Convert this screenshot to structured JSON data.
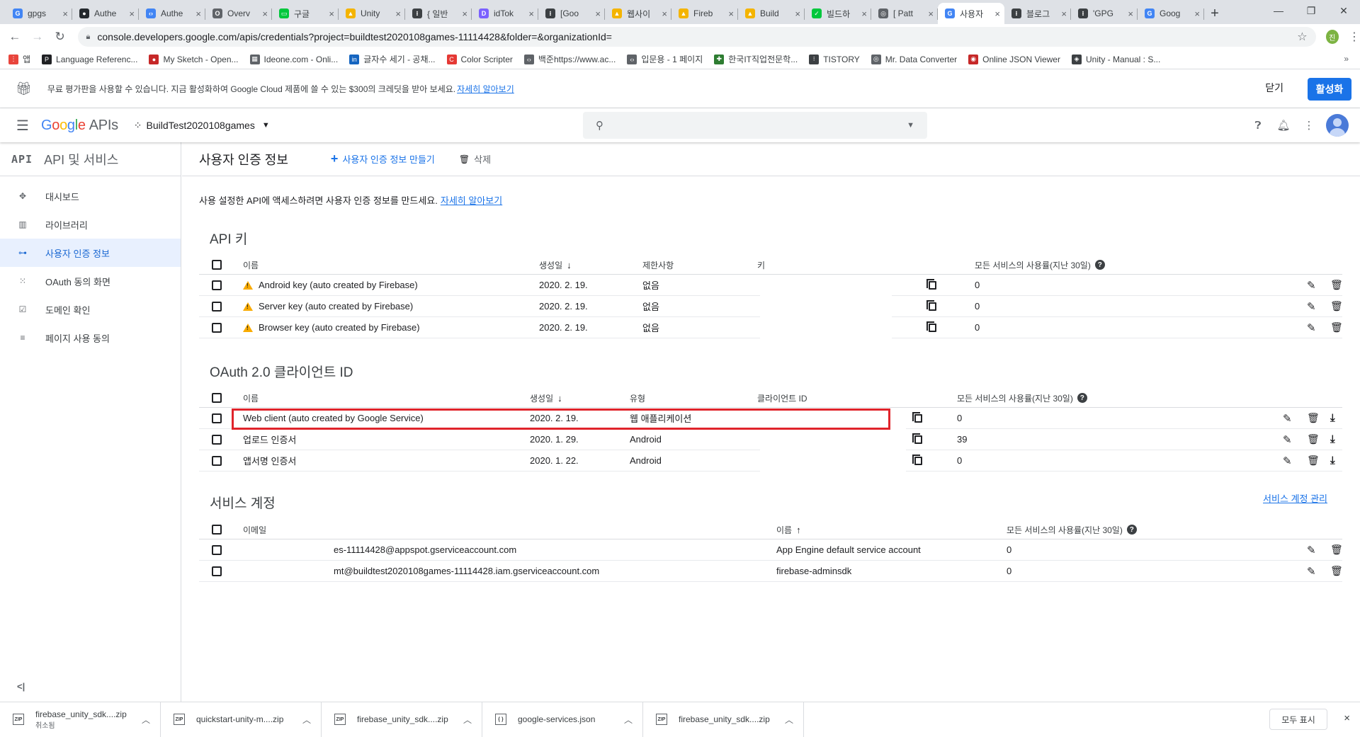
{
  "browser": {
    "tabs": [
      {
        "title": "gpgs",
        "color": "#4285f4",
        "glyph": "G"
      },
      {
        "title": "Authe",
        "color": "#24292e",
        "glyph": "●"
      },
      {
        "title": "Authe",
        "color": "#4285f4",
        "glyph": "‹›"
      },
      {
        "title": "Overv",
        "color": "#5f6368",
        "glyph": "O"
      },
      {
        "title": "구글",
        "color": "#00c73c",
        "glyph": "▭"
      },
      {
        "title": "Unity",
        "color": "#f4b400",
        "glyph": "▲"
      },
      {
        "title": "{ 일반",
        "color": "#3c4043",
        "glyph": "⁝"
      },
      {
        "title": "idTok",
        "color": "#7b61ff",
        "glyph": "D"
      },
      {
        "title": "[Goo",
        "color": "#3c4043",
        "glyph": "⁝"
      },
      {
        "title": "웹사이",
        "color": "#f4b400",
        "glyph": "▲"
      },
      {
        "title": "Fireb",
        "color": "#f4b400",
        "glyph": "▲"
      },
      {
        "title": "Build",
        "color": "#f4b400",
        "glyph": "▲"
      },
      {
        "title": "빌드하",
        "color": "#00c73c",
        "glyph": "✓"
      },
      {
        "title": "[ Patt",
        "color": "#5f6368",
        "glyph": "◎"
      },
      {
        "title": "사용자",
        "color": "#4285f4",
        "glyph": "G",
        "active": true
      },
      {
        "title": "블로그",
        "color": "#3c4043",
        "glyph": "⁝"
      },
      {
        "title": "'GPG",
        "color": "#3c4043",
        "glyph": "⁝"
      },
      {
        "title": "Goog",
        "color": "#4285f4",
        "glyph": "G"
      }
    ],
    "close_glyph": "×",
    "new_tab": "+",
    "url": "console.developers.google.com/apis/credentials?project=buildtest2020108games-11114428&folder=&organizationId=",
    "profile_initial": "진",
    "bookmarks": [
      {
        "label": "앱",
        "color": "#e8453c",
        "glyph": "⋮"
      },
      {
        "label": "Language Referenc...",
        "color": "#202124",
        "glyph": "P"
      },
      {
        "label": "My Sketch - Open...",
        "color": "#c62828",
        "glyph": "●"
      },
      {
        "label": "Ideone.com - Onli...",
        "color": "#5f6368",
        "glyph": "▦"
      },
      {
        "label": "글자수 세기 - 공채...",
        "color": "#1565c0",
        "glyph": "in"
      },
      {
        "label": "Color Scripter",
        "color": "#e53935",
        "glyph": "C"
      },
      {
        "label": "백준https://www.ac...",
        "color": "#5f6368",
        "glyph": "‹›"
      },
      {
        "label": "입문용 - 1 페이지",
        "color": "#5f6368",
        "glyph": "‹›"
      },
      {
        "label": "한국IT직업전문학...",
        "color": "#2e7d32",
        "glyph": "✚"
      },
      {
        "label": "TISTORY",
        "color": "#3c4043",
        "glyph": "⁝"
      },
      {
        "label": "Mr. Data Converter",
        "color": "#5f6368",
        "glyph": "◎"
      },
      {
        "label": "Online JSON Viewer",
        "color": "#c62828",
        "glyph": "◉"
      },
      {
        "label": "Unity - Manual : S...",
        "color": "#3c4043",
        "glyph": "◈"
      }
    ],
    "bookmarks_more": "»"
  },
  "promo": {
    "text": "무료 평가판을 사용할 수 있습니다. 지금 활성화하여 Google Cloud 제품에 쓸 수 있는 $300의 크레딧을 받아 보세요.",
    "link": "자세히 알아보기",
    "close": "닫기",
    "activate": "활성화"
  },
  "header": {
    "logo_google": "Google",
    "logo_apis": "APIs",
    "project": "BuildTest2020108games",
    "search_placeholder": ""
  },
  "sidebar": {
    "badge": "API",
    "title": "API 및 서비스",
    "items": [
      {
        "label": "대시보드",
        "icon": "✥"
      },
      {
        "label": "라이브러리",
        "icon": "▥"
      },
      {
        "label": "사용자 인증 정보",
        "icon": "⊶",
        "active": true
      },
      {
        "label": "OAuth 동의 화면",
        "icon": "⁙"
      },
      {
        "label": "도메인 확인",
        "icon": "☑"
      },
      {
        "label": "페이지 사용 동의",
        "icon": "≡"
      }
    ],
    "collapse": "<|"
  },
  "main": {
    "title": "사용자 인증 정보",
    "create_label": "사용자 인증 정보 만들기",
    "delete_label": "삭제",
    "intro_text": "사용 설정한 API에 액세스하려면 사용자 인증 정보를 만드세요.",
    "intro_link": "자세히 알아보기",
    "api_keys": {
      "heading": "API 키",
      "columns": {
        "name": "이름",
        "created": "생성일",
        "restrictions": "제한사항",
        "key": "키",
        "usage": "모든 서비스의 사용률(지난 30일)"
      },
      "rows": [
        {
          "name": "Android key (auto created by Firebase)",
          "created": "2020. 2. 19.",
          "restrictions": "없음",
          "usage": "0"
        },
        {
          "name": "Server key (auto created by Firebase)",
          "created": "2020. 2. 19.",
          "restrictions": "없음",
          "usage": "0"
        },
        {
          "name": "Browser key (auto created by Firebase)",
          "created": "2020. 2. 19.",
          "restrictions": "없음",
          "usage": "0"
        }
      ]
    },
    "oauth": {
      "heading": "OAuth 2.0 클라이언트 ID",
      "columns": {
        "name": "이름",
        "created": "생성일",
        "type": "유형",
        "client_id": "클라이언트 ID",
        "usage": "모든 서비스의 사용률(지난 30일)"
      },
      "rows": [
        {
          "name": "Web client (auto created by Google Service)",
          "created": "2020. 2. 19.",
          "type": "웹 애플리케이션",
          "usage": "0",
          "highlighted": true
        },
        {
          "name": "업로드 인증서",
          "created": "2020. 1. 29.",
          "type": "Android",
          "usage": "39"
        },
        {
          "name": "앱서명 인증서",
          "created": "2020. 1. 22.",
          "type": "Android",
          "usage": "0"
        }
      ]
    },
    "service_accounts": {
      "heading": "서비스 계정",
      "manage_link": "서비스 계정 관리",
      "columns": {
        "email": "이메일",
        "name": "이름",
        "usage": "모든 서비스의 사용률(지난 30일)"
      },
      "rows": [
        {
          "email": "es-11114428@appspot.gserviceaccount.com",
          "name": "App Engine default service account",
          "usage": "0"
        },
        {
          "email": "mt@buildtest2020108games-11114428.iam.gserviceaccount.com",
          "name": "firebase-adminsdk",
          "usage": "0"
        }
      ]
    },
    "highlight_color": "#e0242b"
  },
  "downloads": {
    "items": [
      {
        "name": "firebase_unity_sdk....zip",
        "status": "취소됨",
        "icon": "ZIP"
      },
      {
        "name": "quickstart-unity-m....zip",
        "status": "",
        "icon": "ZIP"
      },
      {
        "name": "firebase_unity_sdk....zip",
        "status": "",
        "icon": "ZIP"
      },
      {
        "name": "google-services.json",
        "status": "",
        "icon": "{ }"
      },
      {
        "name": "firebase_unity_sdk....zip",
        "status": "",
        "icon": "ZIP"
      }
    ],
    "show_all": "모두 표시",
    "close": "×"
  }
}
